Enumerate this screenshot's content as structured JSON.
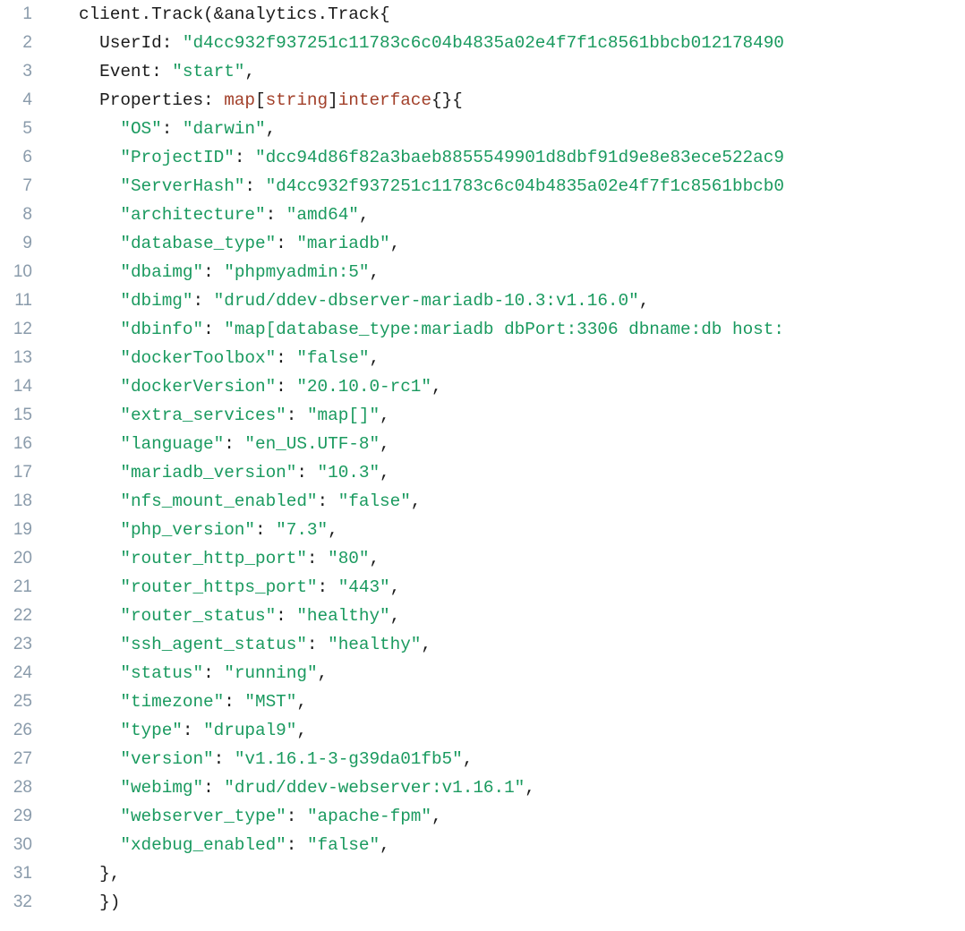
{
  "editor": {
    "language": "go",
    "background_color": "#ffffff",
    "line_number_color": "#8a9bab",
    "first_line_number": 1,
    "last_line_number": 32,
    "total_lines": 32,
    "colors": {
      "plain": "#1b1b1b",
      "string": "#1a9a5f",
      "type": "#a2402a",
      "punctuation": "#1b1b1b"
    }
  },
  "lines": [
    {
      "n": "1",
      "tokens": [
        {
          "t": "client.Track(&analytics.Track{",
          "c": "plain"
        }
      ]
    },
    {
      "n": "2",
      "tokens": [
        {
          "t": "  UserId: ",
          "c": "plain"
        },
        {
          "t": "\"d4cc932f937251c11783c6c04b4835a02e4f7f1c8561bbcb012178490",
          "c": "string"
        }
      ]
    },
    {
      "n": "3",
      "tokens": [
        {
          "t": "  Event: ",
          "c": "plain"
        },
        {
          "t": "\"start\"",
          "c": "string"
        },
        {
          "t": ",",
          "c": "plain"
        }
      ]
    },
    {
      "n": "4",
      "tokens": [
        {
          "t": "  Properties: ",
          "c": "plain"
        },
        {
          "t": "map",
          "c": "type"
        },
        {
          "t": "[",
          "c": "punct"
        },
        {
          "t": "string",
          "c": "type"
        },
        {
          "t": "]",
          "c": "punct"
        },
        {
          "t": "interface",
          "c": "type"
        },
        {
          "t": "{}{",
          "c": "punct"
        }
      ]
    },
    {
      "n": "5",
      "tokens": [
        {
          "t": "    ",
          "c": "plain"
        },
        {
          "t": "\"OS\"",
          "c": "string"
        },
        {
          "t": ": ",
          "c": "plain"
        },
        {
          "t": "\"darwin\"",
          "c": "string"
        },
        {
          "t": ",",
          "c": "plain"
        }
      ]
    },
    {
      "n": "6",
      "tokens": [
        {
          "t": "    ",
          "c": "plain"
        },
        {
          "t": "\"ProjectID\"",
          "c": "string"
        },
        {
          "t": ": ",
          "c": "plain"
        },
        {
          "t": "\"dcc94d86f82a3baeb8855549901d8dbf91d9e8e83ece522ac9",
          "c": "string"
        }
      ]
    },
    {
      "n": "7",
      "tokens": [
        {
          "t": "    ",
          "c": "plain"
        },
        {
          "t": "\"ServerHash\"",
          "c": "string"
        },
        {
          "t": ": ",
          "c": "plain"
        },
        {
          "t": "\"d4cc932f937251c11783c6c04b4835a02e4f7f1c8561bbcb0",
          "c": "string"
        }
      ]
    },
    {
      "n": "8",
      "tokens": [
        {
          "t": "    ",
          "c": "plain"
        },
        {
          "t": "\"architecture\"",
          "c": "string"
        },
        {
          "t": ": ",
          "c": "plain"
        },
        {
          "t": "\"amd64\"",
          "c": "string"
        },
        {
          "t": ",",
          "c": "plain"
        }
      ]
    },
    {
      "n": "9",
      "tokens": [
        {
          "t": "    ",
          "c": "plain"
        },
        {
          "t": "\"database_type\"",
          "c": "string"
        },
        {
          "t": ": ",
          "c": "plain"
        },
        {
          "t": "\"mariadb\"",
          "c": "string"
        },
        {
          "t": ",",
          "c": "plain"
        }
      ]
    },
    {
      "n": "10",
      "tokens": [
        {
          "t": "    ",
          "c": "plain"
        },
        {
          "t": "\"dbaimg\"",
          "c": "string"
        },
        {
          "t": ": ",
          "c": "plain"
        },
        {
          "t": "\"phpmyadmin:5\"",
          "c": "string"
        },
        {
          "t": ",",
          "c": "plain"
        }
      ]
    },
    {
      "n": "11",
      "tokens": [
        {
          "t": "    ",
          "c": "plain"
        },
        {
          "t": "\"dbimg\"",
          "c": "string"
        },
        {
          "t": ": ",
          "c": "plain"
        },
        {
          "t": "\"drud/ddev-dbserver-mariadb-10.3:v1.16.0\"",
          "c": "string"
        },
        {
          "t": ",",
          "c": "plain"
        }
      ]
    },
    {
      "n": "12",
      "tokens": [
        {
          "t": "    ",
          "c": "plain"
        },
        {
          "t": "\"dbinfo\"",
          "c": "string"
        },
        {
          "t": ": ",
          "c": "plain"
        },
        {
          "t": "\"map[database_type:mariadb dbPort:3306 dbname:db host:",
          "c": "string"
        }
      ]
    },
    {
      "n": "13",
      "tokens": [
        {
          "t": "    ",
          "c": "plain"
        },
        {
          "t": "\"dockerToolbox\"",
          "c": "string"
        },
        {
          "t": ": ",
          "c": "plain"
        },
        {
          "t": "\"false\"",
          "c": "string"
        },
        {
          "t": ",",
          "c": "plain"
        }
      ]
    },
    {
      "n": "14",
      "tokens": [
        {
          "t": "    ",
          "c": "plain"
        },
        {
          "t": "\"dockerVersion\"",
          "c": "string"
        },
        {
          "t": ": ",
          "c": "plain"
        },
        {
          "t": "\"20.10.0-rc1\"",
          "c": "string"
        },
        {
          "t": ",",
          "c": "plain"
        }
      ]
    },
    {
      "n": "15",
      "tokens": [
        {
          "t": "    ",
          "c": "plain"
        },
        {
          "t": "\"extra_services\"",
          "c": "string"
        },
        {
          "t": ": ",
          "c": "plain"
        },
        {
          "t": "\"map[]\"",
          "c": "string"
        },
        {
          "t": ",",
          "c": "plain"
        }
      ]
    },
    {
      "n": "16",
      "tokens": [
        {
          "t": "    ",
          "c": "plain"
        },
        {
          "t": "\"language\"",
          "c": "string"
        },
        {
          "t": ": ",
          "c": "plain"
        },
        {
          "t": "\"en_US.UTF-8\"",
          "c": "string"
        },
        {
          "t": ",",
          "c": "plain"
        }
      ]
    },
    {
      "n": "17",
      "tokens": [
        {
          "t": "    ",
          "c": "plain"
        },
        {
          "t": "\"mariadb_version\"",
          "c": "string"
        },
        {
          "t": ": ",
          "c": "plain"
        },
        {
          "t": "\"10.3\"",
          "c": "string"
        },
        {
          "t": ",",
          "c": "plain"
        }
      ]
    },
    {
      "n": "18",
      "tokens": [
        {
          "t": "    ",
          "c": "plain"
        },
        {
          "t": "\"nfs_mount_enabled\"",
          "c": "string"
        },
        {
          "t": ": ",
          "c": "plain"
        },
        {
          "t": "\"false\"",
          "c": "string"
        },
        {
          "t": ",",
          "c": "plain"
        }
      ]
    },
    {
      "n": "19",
      "tokens": [
        {
          "t": "    ",
          "c": "plain"
        },
        {
          "t": "\"php_version\"",
          "c": "string"
        },
        {
          "t": ": ",
          "c": "plain"
        },
        {
          "t": "\"7.3\"",
          "c": "string"
        },
        {
          "t": ",",
          "c": "plain"
        }
      ]
    },
    {
      "n": "20",
      "tokens": [
        {
          "t": "    ",
          "c": "plain"
        },
        {
          "t": "\"router_http_port\"",
          "c": "string"
        },
        {
          "t": ": ",
          "c": "plain"
        },
        {
          "t": "\"80\"",
          "c": "string"
        },
        {
          "t": ",",
          "c": "plain"
        }
      ]
    },
    {
      "n": "21",
      "tokens": [
        {
          "t": "    ",
          "c": "plain"
        },
        {
          "t": "\"router_https_port\"",
          "c": "string"
        },
        {
          "t": ": ",
          "c": "plain"
        },
        {
          "t": "\"443\"",
          "c": "string"
        },
        {
          "t": ",",
          "c": "plain"
        }
      ]
    },
    {
      "n": "22",
      "tokens": [
        {
          "t": "    ",
          "c": "plain"
        },
        {
          "t": "\"router_status\"",
          "c": "string"
        },
        {
          "t": ": ",
          "c": "plain"
        },
        {
          "t": "\"healthy\"",
          "c": "string"
        },
        {
          "t": ",",
          "c": "plain"
        }
      ]
    },
    {
      "n": "23",
      "tokens": [
        {
          "t": "    ",
          "c": "plain"
        },
        {
          "t": "\"ssh_agent_status\"",
          "c": "string"
        },
        {
          "t": ": ",
          "c": "plain"
        },
        {
          "t": "\"healthy\"",
          "c": "string"
        },
        {
          "t": ",",
          "c": "plain"
        }
      ]
    },
    {
      "n": "24",
      "tokens": [
        {
          "t": "    ",
          "c": "plain"
        },
        {
          "t": "\"status\"",
          "c": "string"
        },
        {
          "t": ": ",
          "c": "plain"
        },
        {
          "t": "\"running\"",
          "c": "string"
        },
        {
          "t": ",",
          "c": "plain"
        }
      ]
    },
    {
      "n": "25",
      "tokens": [
        {
          "t": "    ",
          "c": "plain"
        },
        {
          "t": "\"timezone\"",
          "c": "string"
        },
        {
          "t": ": ",
          "c": "plain"
        },
        {
          "t": "\"MST\"",
          "c": "string"
        },
        {
          "t": ",",
          "c": "plain"
        }
      ]
    },
    {
      "n": "26",
      "tokens": [
        {
          "t": "    ",
          "c": "plain"
        },
        {
          "t": "\"type\"",
          "c": "string"
        },
        {
          "t": ": ",
          "c": "plain"
        },
        {
          "t": "\"drupal9\"",
          "c": "string"
        },
        {
          "t": ",",
          "c": "plain"
        }
      ]
    },
    {
      "n": "27",
      "tokens": [
        {
          "t": "    ",
          "c": "plain"
        },
        {
          "t": "\"version\"",
          "c": "string"
        },
        {
          "t": ": ",
          "c": "plain"
        },
        {
          "t": "\"v1.16.1-3-g39da01fb5\"",
          "c": "string"
        },
        {
          "t": ",",
          "c": "plain"
        }
      ]
    },
    {
      "n": "28",
      "tokens": [
        {
          "t": "    ",
          "c": "plain"
        },
        {
          "t": "\"webimg\"",
          "c": "string"
        },
        {
          "t": ": ",
          "c": "plain"
        },
        {
          "t": "\"drud/ddev-webserver:v1.16.1\"",
          "c": "string"
        },
        {
          "t": ",",
          "c": "plain"
        }
      ]
    },
    {
      "n": "29",
      "tokens": [
        {
          "t": "    ",
          "c": "plain"
        },
        {
          "t": "\"webserver_type\"",
          "c": "string"
        },
        {
          "t": ": ",
          "c": "plain"
        },
        {
          "t": "\"apache-fpm\"",
          "c": "string"
        },
        {
          "t": ",",
          "c": "plain"
        }
      ]
    },
    {
      "n": "30",
      "tokens": [
        {
          "t": "    ",
          "c": "plain"
        },
        {
          "t": "\"xdebug_enabled\"",
          "c": "string"
        },
        {
          "t": ": ",
          "c": "plain"
        },
        {
          "t": "\"false\"",
          "c": "string"
        },
        {
          "t": ",",
          "c": "plain"
        }
      ]
    },
    {
      "n": "31",
      "tokens": [
        {
          "t": "  },",
          "c": "plain"
        }
      ]
    },
    {
      "n": "32",
      "tokens": [
        {
          "t": "  })",
          "c": "plain"
        }
      ]
    }
  ]
}
